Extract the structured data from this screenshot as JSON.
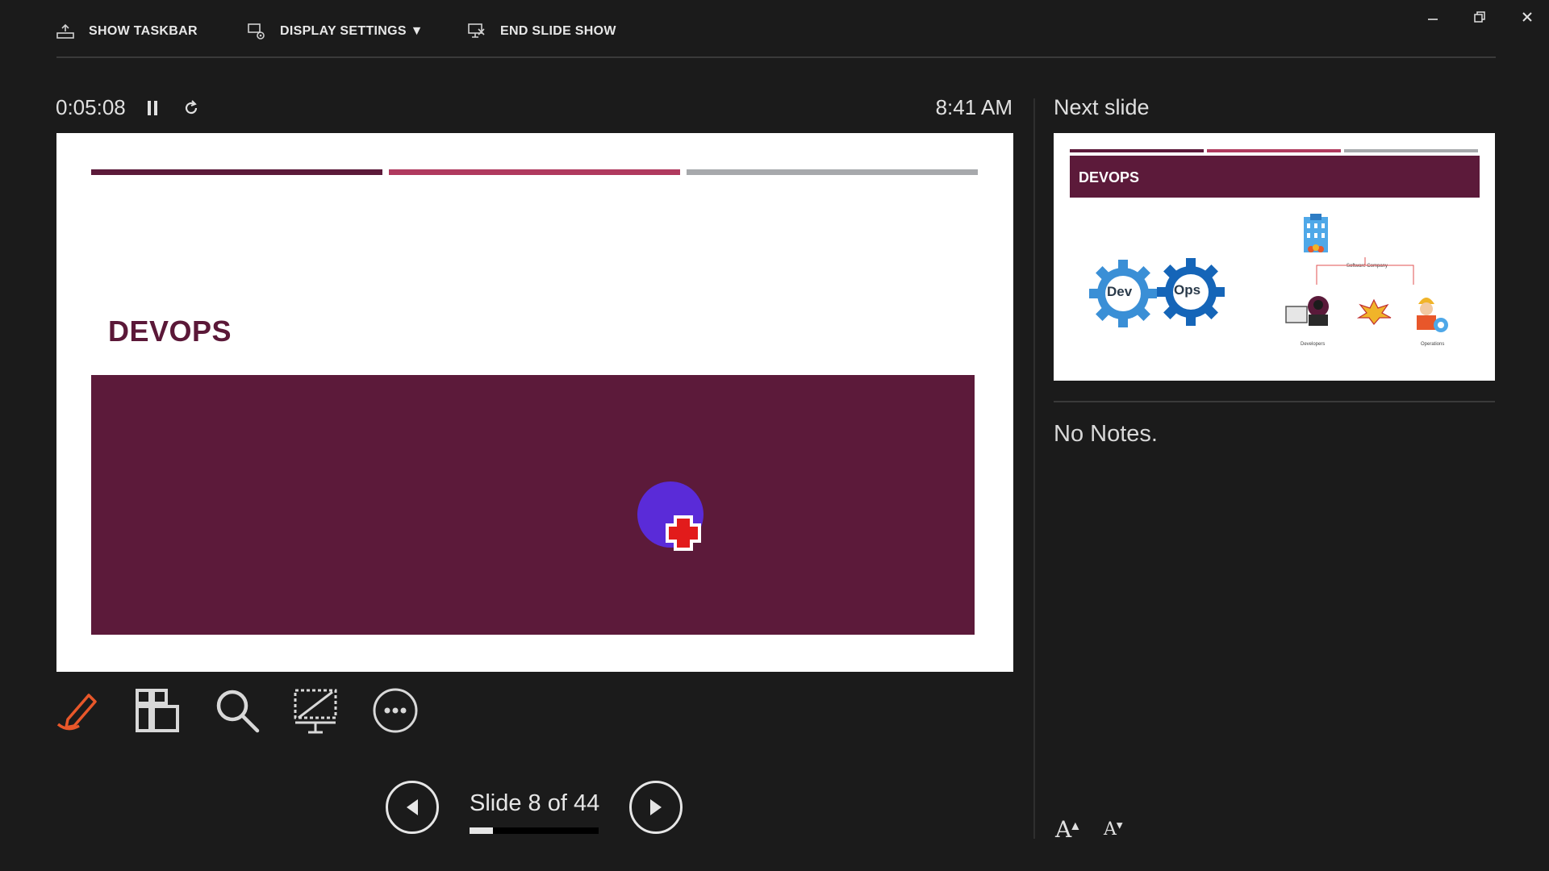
{
  "toolbar": {
    "show_taskbar": "SHOW TASKBAR",
    "display_settings": "DISPLAY SETTINGS ▼",
    "end_slide_show": "END SLIDE SHOW"
  },
  "window_controls": [
    "minimize-icon",
    "restore-icon",
    "close-icon"
  ],
  "timer": {
    "elapsed": "0:05:08",
    "clock": "8:41 AM"
  },
  "current_slide": {
    "title": "DEVOPS",
    "header_bar_colors": [
      "#5c1a3a",
      "#b03a5e",
      "#a7a9ac"
    ],
    "panel_color": "#5c1a3a"
  },
  "next_slide": {
    "label": "Next slide",
    "title": "DEVOPS",
    "gear_labels": [
      "Dev",
      "Ops"
    ],
    "diagram_labels": [
      "Software Company",
      "Developers",
      "Operations"
    ]
  },
  "notes": {
    "text": "No Notes."
  },
  "tools": [
    "pen-icon",
    "see-all-slides-icon",
    "zoom-icon",
    "black-screen-icon",
    "more-options-icon"
  ],
  "navigation": {
    "counter": "Slide 8 of 44",
    "current": 8,
    "total": 44,
    "progress_fraction": 0.18
  },
  "font_controls": {
    "increase": "A",
    "decrease": "A"
  },
  "colors": {
    "accent": "#e8572a",
    "background": "#1b1b1b",
    "cursor_dot": "#5a2bd8"
  }
}
